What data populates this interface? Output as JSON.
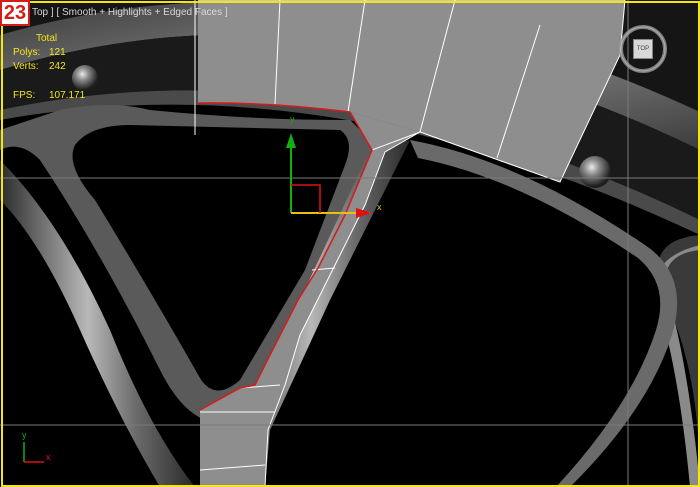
{
  "step_number": "23",
  "viewport": {
    "label": "Top ] [ Smooth + Highlights + Edged Faces ]",
    "stats": {
      "header": "Total",
      "polys_label": "Polys:",
      "polys_value": "121",
      "verts_label": "Verts:",
      "verts_value": "242",
      "fps_label": "FPS:",
      "fps_value": "107.171"
    },
    "gizmo": {
      "x_label": "x",
      "y_label": "y"
    },
    "axis_tripod": {
      "x_label": "x",
      "y_label": "y"
    },
    "viewcube": {
      "face_label": "TOP"
    }
  },
  "colors": {
    "frame": "#f2e51a",
    "stats_text": "#f2e51a",
    "mesh_fill": "#8e8e8e",
    "mesh_edges": "#ffffff",
    "selection_edge": "#d61b1b",
    "gizmo_x": "#e01010",
    "gizmo_y": "#10b010",
    "rim_metal": "#6e6e6e",
    "background": "#000000"
  }
}
